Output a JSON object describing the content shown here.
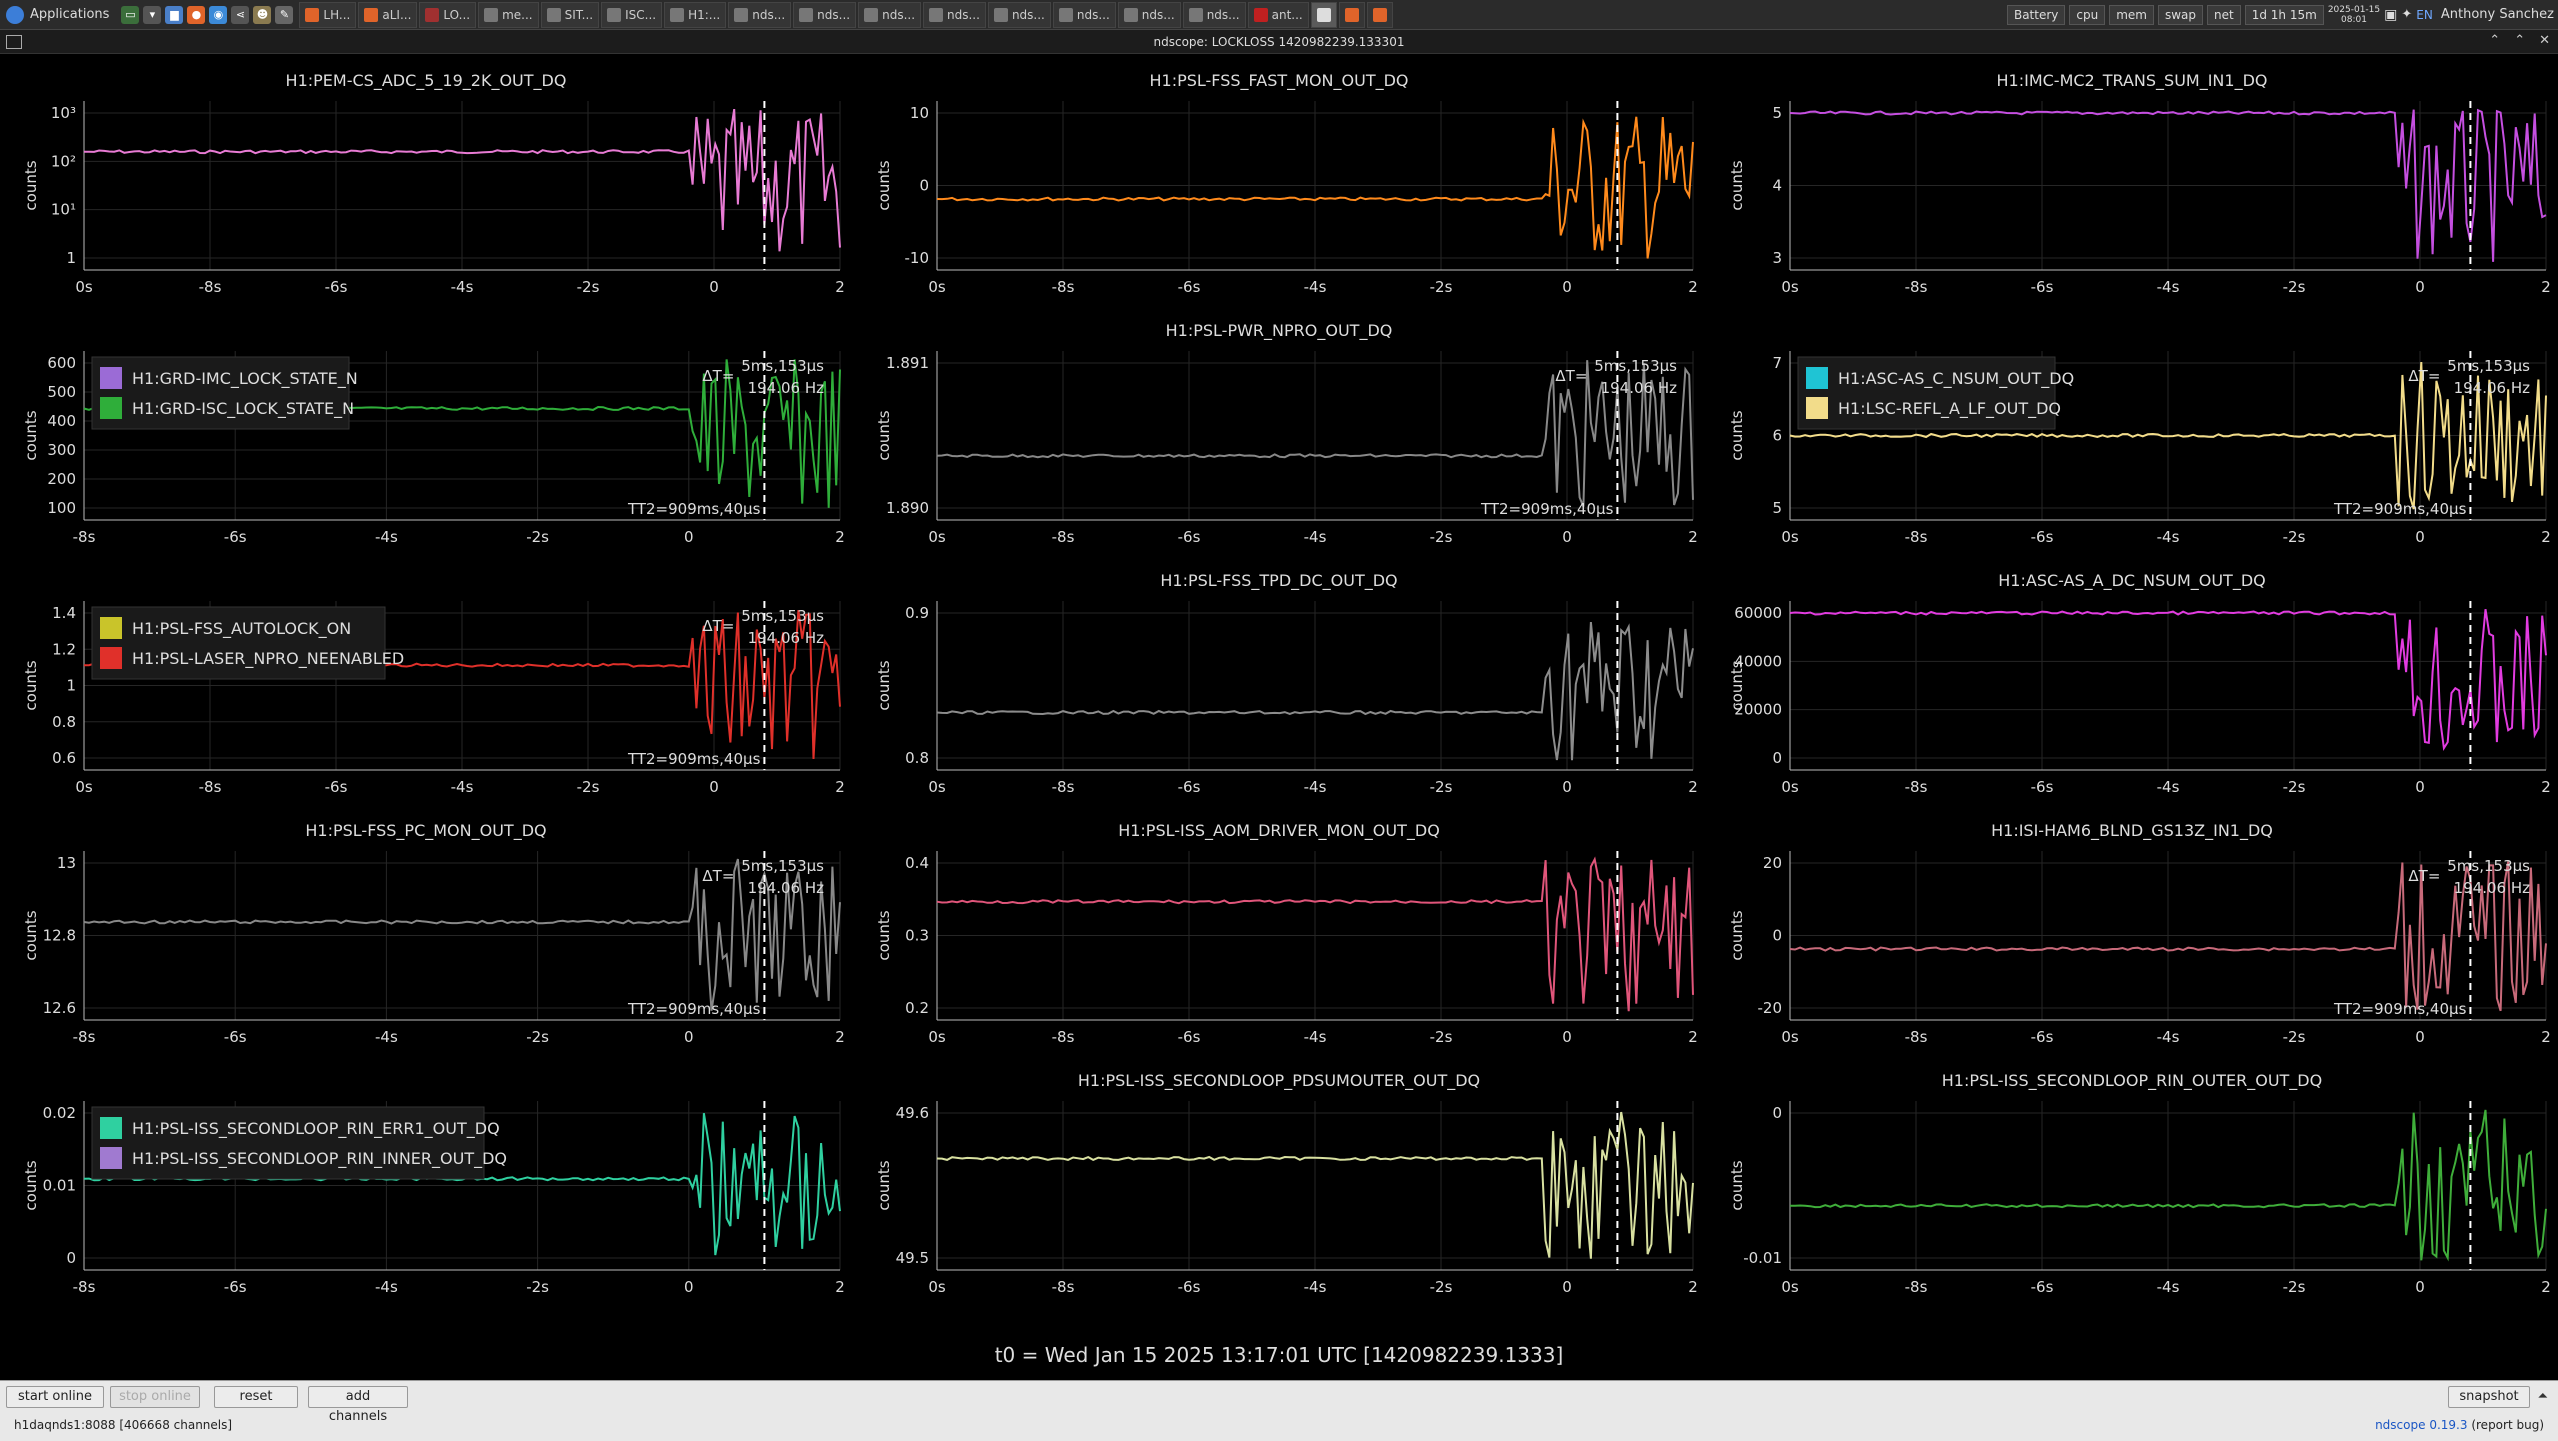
{
  "taskbar": {
    "apps_label": "Applications",
    "windows": [
      {
        "label": "LH..."
      },
      {
        "label": "aLI..."
      },
      {
        "label": "LO..."
      },
      {
        "label": "me..."
      },
      {
        "label": "SIT..."
      },
      {
        "label": "ISC..."
      },
      {
        "label": "H1:..."
      },
      {
        "label": "nds..."
      },
      {
        "label": "nds..."
      },
      {
        "label": "nds..."
      },
      {
        "label": "nds..."
      },
      {
        "label": "nds..."
      },
      {
        "label": "nds..."
      },
      {
        "label": "nds..."
      },
      {
        "label": "nds..."
      },
      {
        "label": "ant..."
      }
    ],
    "battery": "Battery",
    "cpu": "cpu",
    "mem": "mem",
    "swap": "swap",
    "net": "net",
    "uptime": "1d 1h 15m",
    "date": "2025-01-15",
    "time": "08:01",
    "lang": "EN",
    "user": "Anthony Sanchez"
  },
  "window": {
    "title": "ndscope: LOCKLOSS 1420982239.133301"
  },
  "plots": [
    {
      "title": "H1:PEM-CS_ADC_5_19_2K_OUT_DQ",
      "ylabel": "counts",
      "yticks": [
        "10³",
        "10²",
        "10¹",
        "1"
      ],
      "xticks": [
        "0s",
        "-8s",
        "-6s",
        "-4s",
        "-2s",
        "0",
        "2"
      ],
      "legend": [],
      "delta": null,
      "tt2": null,
      "color": "#e87bd4"
    },
    {
      "title": "H1:PSL-FSS_FAST_MON_OUT_DQ",
      "ylabel": "counts",
      "yticks": [
        "10",
        "0",
        "-10"
      ],
      "xticks": [
        "0s",
        "-8s",
        "-6s",
        "-4s",
        "-2s",
        "0",
        "2"
      ],
      "legend": [],
      "delta": null,
      "tt2": null,
      "color": "#ff8a1c"
    },
    {
      "title": "H1:IMC-MC2_TRANS_SUM_IN1_DQ",
      "ylabel": "counts",
      "yticks": [
        "5",
        "4",
        "3"
      ],
      "xticks": [
        "0s",
        "-8s",
        "-6s",
        "-4s",
        "-2s",
        "0",
        "2"
      ],
      "legend": [],
      "delta": null,
      "tt2": null,
      "color": "#c54fe0"
    },
    {
      "title": "",
      "ylabel": "counts",
      "yticks": [
        "600",
        "500",
        "400",
        "300",
        "200",
        "100"
      ],
      "xticks": [
        "-8s",
        "-6s",
        "-4s",
        "-2s",
        "0",
        "2"
      ],
      "legend": [
        {
          "name": "H1:GRD-IMC_LOCK_STATE_N",
          "color": "#9b6bd6"
        },
        {
          "name": "H1:GRD-ISC_LOCK_STATE_N",
          "color": "#2fae3a"
        }
      ],
      "delta": "ΔT=",
      "delta_val": "5ms,153μs",
      "freq": "194.06 Hz",
      "tt2": "TT2=909ms,40μs",
      "color": "#2fae3a"
    },
    {
      "title": "H1:PSL-PWR_NPRO_OUT_DQ",
      "ylabel": "counts",
      "yticks": [
        "1.891",
        "1.890"
      ],
      "xticks": [
        "0s",
        "-8s",
        "-6s",
        "-4s",
        "-2s",
        "0",
        "2"
      ],
      "legend": [],
      "delta": "ΔT=",
      "delta_val": "5ms,153μs",
      "freq": "194.06 Hz",
      "tt2": "TT2=909ms,40μs",
      "color": "#888"
    },
    {
      "title": "",
      "ylabel": "counts",
      "yticks": [
        "7",
        "6",
        "5"
      ],
      "xticks": [
        "0s",
        "-8s",
        "-6s",
        "-4s",
        "-2s",
        "0",
        "2"
      ],
      "legend": [
        {
          "name": "H1:ASC-AS_C_NSUM_OUT_DQ",
          "color": "#1fc4d4"
        },
        {
          "name": "H1:LSC-REFL_A_LF_OUT_DQ",
          "color": "#f2dc8a"
        }
      ],
      "delta": "ΔT=",
      "delta_val": "5ms,153μs",
      "freq": "194.06 Hz",
      "tt2": "TT2=909ms,40μs",
      "color": "#f2dc8a"
    },
    {
      "title": "",
      "ylabel": "counts",
      "yticks": [
        "1.4",
        "1.2",
        "1",
        "0.8",
        "0.6"
      ],
      "xticks": [
        "0s",
        "-8s",
        "-6s",
        "-4s",
        "-2s",
        "0",
        "2"
      ],
      "legend": [
        {
          "name": "H1:PSL-FSS_AUTOLOCK_ON",
          "color": "#c9c42a"
        },
        {
          "name": "H1:PSL-LASER_NPRO_NEENABLED",
          "color": "#e0302a"
        }
      ],
      "delta": "ΔT=",
      "delta_val": "5ms,153μs",
      "freq": "194.06 Hz",
      "tt2": "TT2=909ms,40μs",
      "color": "#e0302a"
    },
    {
      "title": "H1:PSL-FSS_TPD_DC_OUT_DQ",
      "ylabel": "counts",
      "yticks": [
        "0.9",
        "0.8"
      ],
      "xticks": [
        "0s",
        "-8s",
        "-6s",
        "-4s",
        "-2s",
        "0",
        "2"
      ],
      "legend": [],
      "delta": null,
      "tt2": null,
      "color": "#8c8c8c"
    },
    {
      "title": "H1:ASC-AS_A_DC_NSUM_OUT_DQ",
      "ylabel": "counts",
      "yticks": [
        "60000",
        "40000",
        "20000",
        "0"
      ],
      "xticks": [
        "0s",
        "-8s",
        "-6s",
        "-4s",
        "-2s",
        "0",
        "2"
      ],
      "legend": [],
      "delta": null,
      "tt2": null,
      "color": "#e23ce0"
    },
    {
      "title": "H1:PSL-FSS_PC_MON_OUT_DQ",
      "ylabel": "counts",
      "yticks": [
        "13",
        "12.8",
        "12.6"
      ],
      "xticks": [
        "-8s",
        "-6s",
        "-4s",
        "-2s",
        "0",
        "2"
      ],
      "legend": [],
      "delta": "ΔT=",
      "delta_val": "5ms,153μs",
      "freq": "194.06 Hz",
      "tt2": "TT2=909ms,40μs",
      "color": "#888"
    },
    {
      "title": "H1:PSL-ISS_AOM_DRIVER_MON_OUT_DQ",
      "ylabel": "counts",
      "yticks": [
        "0.4",
        "0.3",
        "0.2"
      ],
      "xticks": [
        "0s",
        "-8s",
        "-6s",
        "-4s",
        "-2s",
        "0",
        "2"
      ],
      "legend": [],
      "delta": null,
      "tt2": null,
      "color": "#e0557a"
    },
    {
      "title": "H1:ISI-HAM6_BLND_GS13Z_IN1_DQ",
      "ylabel": "counts",
      "yticks": [
        "20",
        "0",
        "-20"
      ],
      "xticks": [
        "0s",
        "-8s",
        "-6s",
        "-4s",
        "-2s",
        "0",
        "2"
      ],
      "legend": [],
      "delta": "ΔT=",
      "delta_val": "5ms,153μs",
      "freq": "194.06 Hz",
      "tt2": "TT2=909ms,40μs",
      "color": "#c86a7a"
    },
    {
      "title": "",
      "ylabel": "counts",
      "yticks": [
        "0.02",
        "0.01",
        "0"
      ],
      "xticks": [
        "-8s",
        "-6s",
        "-4s",
        "-2s",
        "0",
        "2"
      ],
      "legend": [
        {
          "name": "H1:PSL-ISS_SECONDLOOP_RIN_ERR1_OUT_DQ",
          "color": "#2fd0a0"
        },
        {
          "name": "H1:PSL-ISS_SECONDLOOP_RIN_INNER_OUT_DQ",
          "color": "#a07ad0"
        }
      ],
      "delta": null,
      "tt2": null,
      "color": "#2fd0a0"
    },
    {
      "title": "H1:PSL-ISS_SECONDLOOP_PDSUMOUTER_OUT_DQ",
      "ylabel": "counts",
      "yticks": [
        "49.6",
        "49.5"
      ],
      "xticks": [
        "0s",
        "-8s",
        "-6s",
        "-4s",
        "-2s",
        "0",
        "2"
      ],
      "legend": [],
      "delta": null,
      "tt2": null,
      "color": "#d8e0a0"
    },
    {
      "title": "H1:PSL-ISS_SECONDLOOP_RIN_OUTER_OUT_DQ",
      "ylabel": "counts",
      "yticks": [
        "0",
        "-0.01"
      ],
      "xticks": [
        "0s",
        "-8s",
        "-6s",
        "-4s",
        "-2s",
        "0",
        "2"
      ],
      "legend": [],
      "delta": null,
      "tt2": null,
      "color": "#3fae3a"
    }
  ],
  "t0_label": "t0 = Wed Jan 15 2025 13:17:01 UTC [1420982239.1333]",
  "buttons": {
    "start_online": "start online",
    "stop_online": "stop online",
    "reset": "reset",
    "add_channels": "add channels",
    "snapshot": "snapshot"
  },
  "status": "h1daqnds1:8088  [406668 channels]",
  "credit": {
    "name": "ndscope",
    "version": "0.19.3",
    "report": "(report bug)"
  }
}
